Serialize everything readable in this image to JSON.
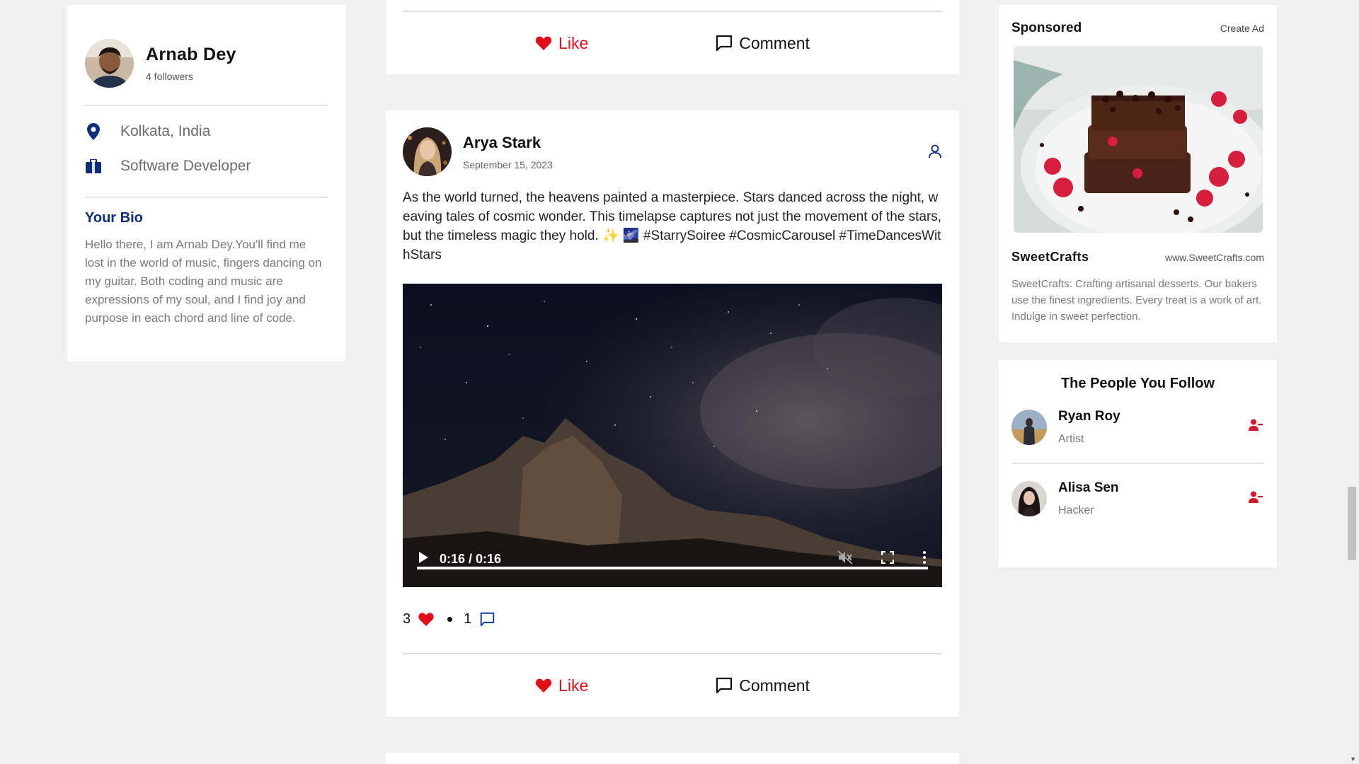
{
  "profile": {
    "name": "Arnab Dey",
    "followers": "4 followers",
    "location": "Kolkata, India",
    "occupation": "Software Developer",
    "bio_title": "Your Bio",
    "bio": "Hello there, I am Arnab Dey.You'll find me lost in the world of music, fingers dancing on my guitar. Both coding and music are expressions of my soul, and I find joy and purpose in each chord and line of code."
  },
  "post": {
    "author": "Arya Stark",
    "date": "September 15, 2023",
    "text": "As the world turned, the heavens painted a masterpiece. Stars danced across the night, weaving tales of cosmic wonder. This timelapse captures not just the movement of the stars, but the timeless magic they hold. ✨ 🌌 #StarrySoiree #CosmicCarousel #TimeDancesWithStars",
    "video_time": "0:16 / 0:16",
    "video_progress": 1.0,
    "likes": "3",
    "comments": "1"
  },
  "actions": {
    "like_label": "Like",
    "comment_label": "Comment"
  },
  "sponsored": {
    "title": "Sponsored",
    "create_ad": "Create Ad",
    "brand": "SweetCrafts",
    "url": "www.SweetCrafts.com",
    "description": "SweetCrafts: Crafting artisanal desserts. Our bakers use the finest ingredients. Every treat is a work of art. Indulge in sweet perfection."
  },
  "following": {
    "title": "The People You Follow",
    "people": [
      {
        "name": "Ryan Roy",
        "role": "Artist"
      },
      {
        "name": "Alisa Sen",
        "role": "Hacker"
      }
    ]
  },
  "colors": {
    "accent_blue": "#0d2d78",
    "like_red": "#e0101a",
    "background": "#f0f0f0"
  },
  "icons": {
    "location": "location-pin-icon",
    "occupation": "briefcase-icon",
    "like": "heart-icon",
    "comment": "comment-icon",
    "follow": "user-icon",
    "unfollow": "user-minus-icon"
  }
}
